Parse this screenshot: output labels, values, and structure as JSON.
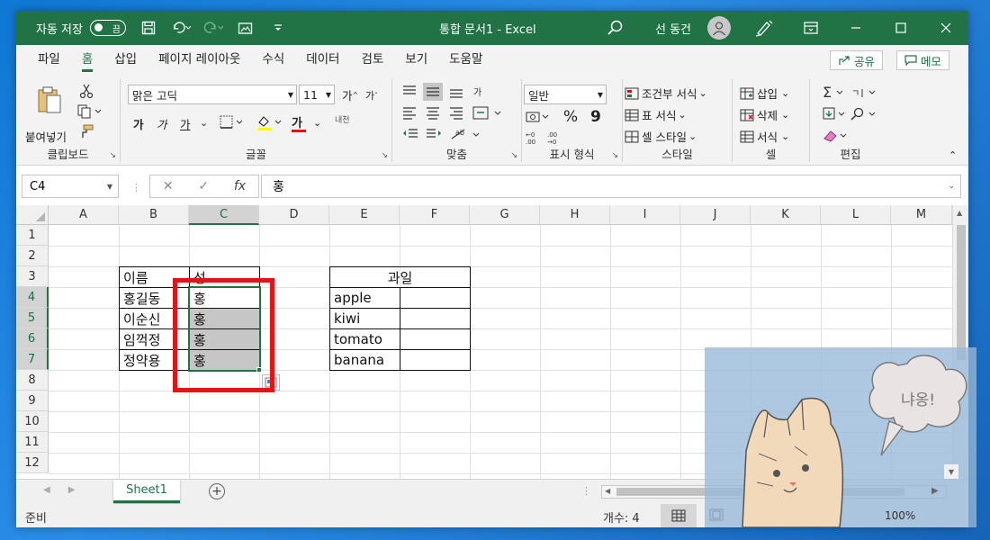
{
  "titlebar": {
    "autosave_label": "자동 저장",
    "autosave_state": "끔",
    "title": "통합 문서1  -  Excel",
    "user": "선 동건"
  },
  "tabs": [
    "파일",
    "홈",
    "삽입",
    "페이지 레이아웃",
    "수식",
    "데이터",
    "검토",
    "보기",
    "도움말"
  ],
  "active_tab": "홈",
  "share_label": "공유",
  "memo_label": "메모",
  "ribbon": {
    "clipboard": {
      "paste": "붙여넣기",
      "label": "클립보드"
    },
    "font": {
      "name": "맑은 고딕",
      "size": "11",
      "bold": "가",
      "italic": "가",
      "underline": "가",
      "color_letter": "가",
      "label": "글꼴",
      "phonetic": "내천"
    },
    "alignment": {
      "label": "맞춤"
    },
    "number": {
      "format": "일반",
      "percent": "%",
      "comma": "9",
      "label": "표시 형식"
    },
    "styles": {
      "conditional": "조건부 서식",
      "table": "표 서식",
      "cell": "셀 스타일",
      "label": "스타일"
    },
    "cells": {
      "insert": "삽입",
      "delete": "삭제",
      "format": "서식",
      "label": "셀"
    },
    "editing": {
      "label": "편집"
    }
  },
  "formula_bar": {
    "name_box": "C4",
    "fx": "fx",
    "value": "홍"
  },
  "columns": [
    "A",
    "B",
    "C",
    "D",
    "E",
    "F",
    "G",
    "H",
    "I",
    "J",
    "K",
    "L",
    "M"
  ],
  "rows": [
    "1",
    "2",
    "3",
    "4",
    "5",
    "6",
    "7",
    "8",
    "9",
    "10",
    "11",
    "12"
  ],
  "cells": {
    "b3": "이름",
    "c3": "성",
    "b4": "홍길동",
    "c4": "홍",
    "b5": "이순신",
    "c5": "홍",
    "b6": "임꺽정",
    "c6": "홍",
    "b7": "정약용",
    "c7": "홍",
    "e3": "과일",
    "e4": "apple",
    "e5": "kiwi",
    "e6": "tomato",
    "e7": "banana"
  },
  "sheet_tab": "Sheet1",
  "status": {
    "ready": "준비",
    "count": "개수: 4",
    "zoom": "100%"
  },
  "overlay_text": "냐옹!",
  "colors": {
    "excel_green": "#217346",
    "highlight_red": "#e51414",
    "selection_gray": "#c6c6c6"
  }
}
